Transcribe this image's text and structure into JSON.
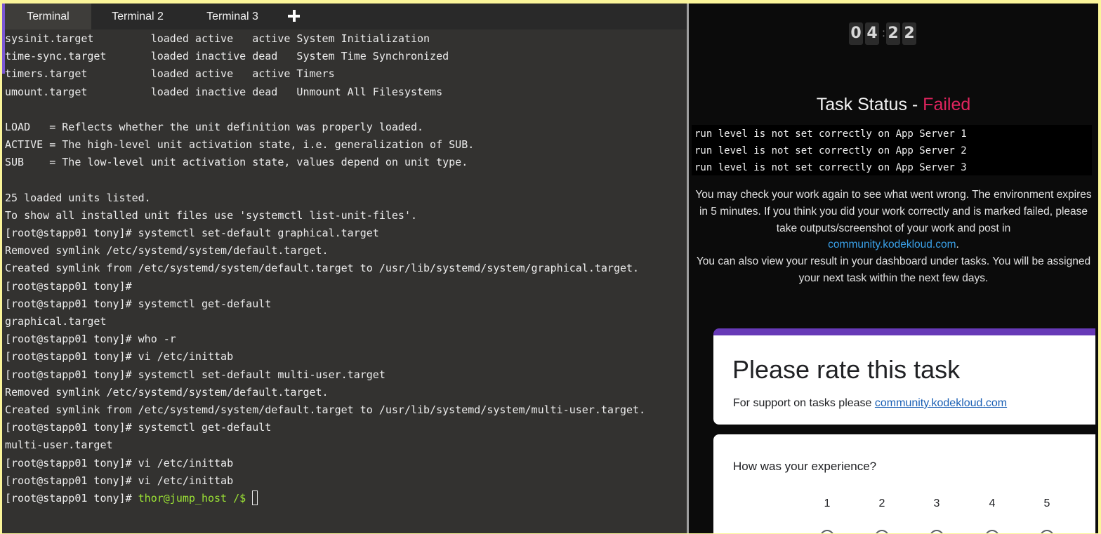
{
  "tabs": [
    {
      "label": "Terminal",
      "active": true
    },
    {
      "label": "Terminal 2",
      "active": false
    },
    {
      "label": "Terminal 3",
      "active": false
    }
  ],
  "add_tab_icon": "plus-icon",
  "terminal": {
    "lines": [
      "sysinit.target         loaded active   active System Initialization",
      "time-sync.target       loaded inactive dead   System Time Synchronized",
      "timers.target          loaded active   active Timers",
      "umount.target          loaded inactive dead   Unmount All Filesystems",
      "",
      "LOAD   = Reflects whether the unit definition was properly loaded.",
      "ACTIVE = The high-level unit activation state, i.e. generalization of SUB.",
      "SUB    = The low-level unit activation state, values depend on unit type.",
      "",
      "25 loaded units listed.",
      "To show all installed unit files use 'systemctl list-unit-files'.",
      "[root@stapp01 tony]# systemctl set-default graphical.target",
      "Removed symlink /etc/systemd/system/default.target.",
      "Created symlink from /etc/systemd/system/default.target to /usr/lib/systemd/system/graphical.target.",
      "[root@stapp01 tony]#",
      "[root@stapp01 tony]# systemctl get-default",
      "graphical.target",
      "[root@stapp01 tony]# who -r",
      "[root@stapp01 tony]# vi /etc/inittab",
      "[root@stapp01 tony]# systemctl set-default multi-user.target",
      "Removed symlink /etc/systemd/system/default.target.",
      "Created symlink from /etc/systemd/system/default.target to /usr/lib/systemd/system/multi-user.target.",
      "[root@stapp01 tony]# systemctl get-default",
      "multi-user.target",
      "[root@stapp01 tony]# vi /etc/inittab",
      "[root@stapp01 tony]# vi /etc/inittab"
    ],
    "last_line_prefix": "[root@stapp01 tony]# ",
    "last_line_prompt": "thor@jump_host /$ ",
    "prompt_color": "#9be235"
  },
  "timer": {
    "minutes": [
      "0",
      "4"
    ],
    "seconds": [
      "2",
      "2"
    ]
  },
  "status": {
    "title_prefix": "Task Status - ",
    "result": "Failed",
    "result_color": "#e0245e",
    "errors": [
      "run level is not set correctly on App Server 1",
      "run level is not set correctly on App Server 2",
      "run level is not set correctly on App Server 3"
    ],
    "message_1": "You may check your work again to see what went wrong. The environment expires in 5 minutes. If you think you did your work correctly and is marked failed, please take outputs/screenshot of your work and post in",
    "message_link": "community.kodekloud.com",
    "message_link_suffix": ".",
    "message_2": "You can also view your result in your dashboard under tasks. You will be assigned your next task within the next few days."
  },
  "rating": {
    "title": "Please rate this task",
    "support_text": "For support on tasks please ",
    "support_link": "community.kodekloud.com",
    "accent_color": "#673ab7"
  },
  "experience": {
    "question": "How was your experience?",
    "scale": [
      "1",
      "2",
      "3",
      "4",
      "5"
    ]
  }
}
